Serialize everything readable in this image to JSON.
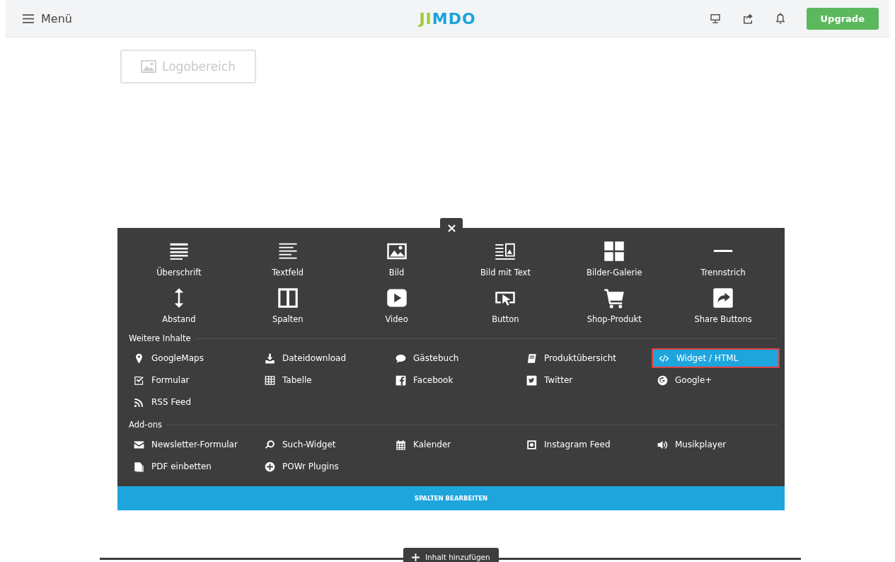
{
  "topbar": {
    "menu_label": "Menü",
    "logo": "JIMDO",
    "upgrade": "Upgrade"
  },
  "logo_area": {
    "label": "Logobereich"
  },
  "panel": {
    "tiles": [
      {
        "label": "Überschrift"
      },
      {
        "label": "Textfeld"
      },
      {
        "label": "Bild"
      },
      {
        "label": "Bild mit Text"
      },
      {
        "label": "Bilder-Galerie"
      },
      {
        "label": "Trennstrich"
      },
      {
        "label": "Abstand"
      },
      {
        "label": "Spalten"
      },
      {
        "label": "Video"
      },
      {
        "label": "Button"
      },
      {
        "label": "Shop-Produkt"
      },
      {
        "label": "Share Buttons"
      }
    ],
    "sections": [
      {
        "title": "Weitere Inhalte",
        "items": [
          {
            "label": "GoogleMaps",
            "selected": false
          },
          {
            "label": "Dateidownload",
            "selected": false
          },
          {
            "label": "Gästebuch",
            "selected": false
          },
          {
            "label": "Produktübersicht",
            "selected": false
          },
          {
            "label": "Widget / HTML",
            "selected": true
          },
          {
            "label": "Formular",
            "selected": false
          },
          {
            "label": "Tabelle",
            "selected": false
          },
          {
            "label": "Facebook",
            "selected": false
          },
          {
            "label": "Twitter",
            "selected": false
          },
          {
            "label": "Google+",
            "selected": false
          },
          {
            "label": "RSS Feed",
            "selected": false
          }
        ]
      },
      {
        "title": "Add-ons",
        "items": [
          {
            "label": "Newsletter-Formular",
            "selected": false
          },
          {
            "label": "Such-Widget",
            "selected": false
          },
          {
            "label": "Kalender",
            "selected": false
          },
          {
            "label": "Instagram Feed",
            "selected": false
          },
          {
            "label": "Musikplayer",
            "selected": false
          },
          {
            "label": "PDF einbetten",
            "selected": false
          },
          {
            "label": "POWr Plugins",
            "selected": false
          }
        ]
      }
    ],
    "footer_button": "SPALTEN BEARBEITEN"
  },
  "add_content": {
    "label": "Inhalt hinzufügen"
  }
}
